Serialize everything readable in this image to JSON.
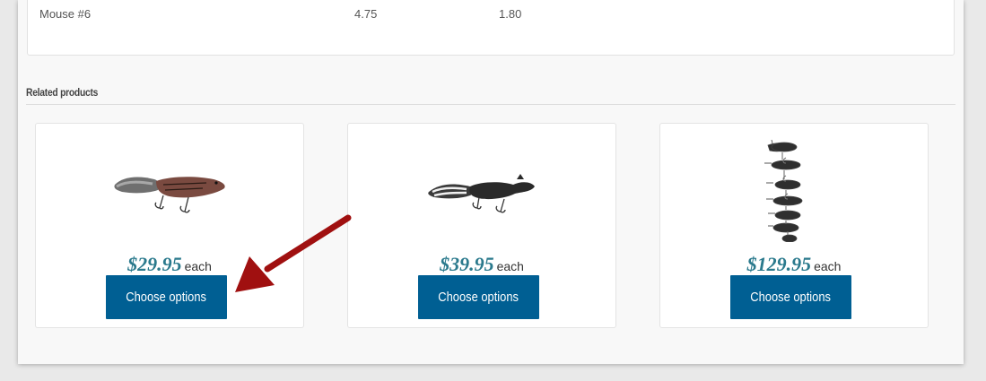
{
  "table_row": {
    "name": "Mouse #6",
    "value1": "4.75",
    "value2": "1.80"
  },
  "related": {
    "title": "Related products",
    "products": [
      {
        "price": "$29.95",
        "unit": "each",
        "button": "Choose options",
        "image_icon": "squirrel-lure-brown"
      },
      {
        "price": "$39.95",
        "unit": "each",
        "button": "Choose options",
        "image_icon": "squirrel-lure-black"
      },
      {
        "price": "$129.95",
        "unit": "each",
        "button": "Choose options",
        "image_icon": "mouse-lure-set"
      }
    ]
  },
  "colors": {
    "price": "#2b7a8d",
    "button": "#005f93",
    "arrow": "#a01010"
  }
}
